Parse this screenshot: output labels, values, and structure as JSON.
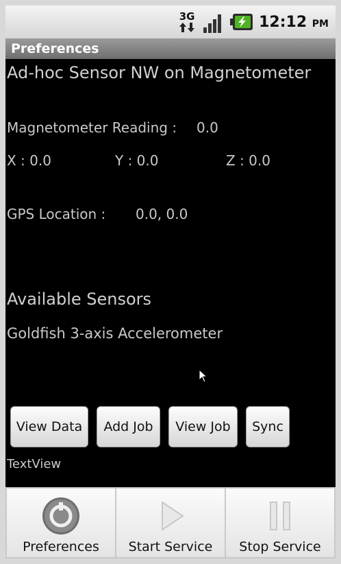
{
  "status_bar": {
    "network_type": "3G",
    "time": "12:12",
    "ampm": "PM",
    "icons": [
      "3g-data-icon",
      "signal-strength-icon",
      "battery-charging-icon"
    ]
  },
  "titlebar": {
    "title": "Preferences"
  },
  "main": {
    "heading": "Ad-hoc Sensor NW on Magnetometer",
    "magnetometer_label": "Magnetometer Reading :",
    "magnetometer_value": "0.0",
    "x": "X : 0.0",
    "y": "Y : 0.0",
    "z": "Z : 0.0",
    "gps_label": "GPS Location :",
    "gps_value": "0.0, 0.0",
    "available_heading": "Available Sensors",
    "sensor_name": "Goldfish 3-axis Accelerometer",
    "textview": "TextView"
  },
  "buttons": {
    "view_data": "View Data",
    "add_job": "Add Job",
    "view_job": "View Job",
    "sync": "Sync"
  },
  "bottom_menu": {
    "preferences": "Preferences",
    "start_service": "Start Service",
    "stop_service": "Stop Service"
  }
}
